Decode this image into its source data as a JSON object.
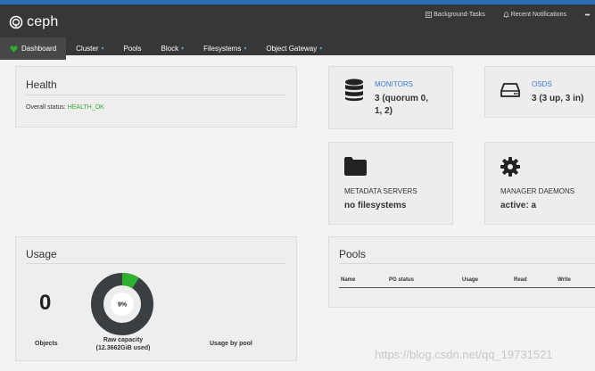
{
  "brand": {
    "name": "ceph"
  },
  "utilities": {
    "background_tasks": "Background-Tasks",
    "notifications": "Recent Notifications"
  },
  "nav": [
    {
      "label": "Dashboard"
    },
    {
      "label": "Cluster"
    },
    {
      "label": "Pools"
    },
    {
      "label": "Block"
    },
    {
      "label": "Filesystems"
    },
    {
      "label": "Object Gateway"
    }
  ],
  "health": {
    "title": "Health",
    "status_label": "Overall status:",
    "status_value": "HEALTH_OK"
  },
  "monitors": {
    "label": "MONITORS",
    "value_line1": "3 (quorum 0,",
    "value_line2": "1, 2)"
  },
  "osds": {
    "label": "OSDS",
    "value": "3 (3 up, 3 in)"
  },
  "metadata": {
    "label": "METADATA SERVERS",
    "value": "no filesystems"
  },
  "manager": {
    "label": "MANAGER DAEMONS",
    "value": "active: a"
  },
  "usage": {
    "title": "Usage",
    "objects_value": "0",
    "objects_label": "Objects",
    "raw_capacity_label": "Raw capacity",
    "raw_capacity_detail": "(12.3662GiB used)",
    "raw_used_percent_text": "9%",
    "raw_used_fraction": 0.09,
    "usage_by_pool_label": "Usage by pool"
  },
  "pools": {
    "title": "Pools",
    "columns": [
      "Name",
      "PG status",
      "Usage",
      "Read",
      "Write"
    ]
  },
  "watermark": "https://blog.csdn.net/qq_19731521",
  "colors": {
    "header_bg": "#373737",
    "accent_blue": "#3a7bd5",
    "ok_green": "#2fae2f",
    "donut_used": "#2fb22f",
    "donut_free": "#3a3f44"
  }
}
